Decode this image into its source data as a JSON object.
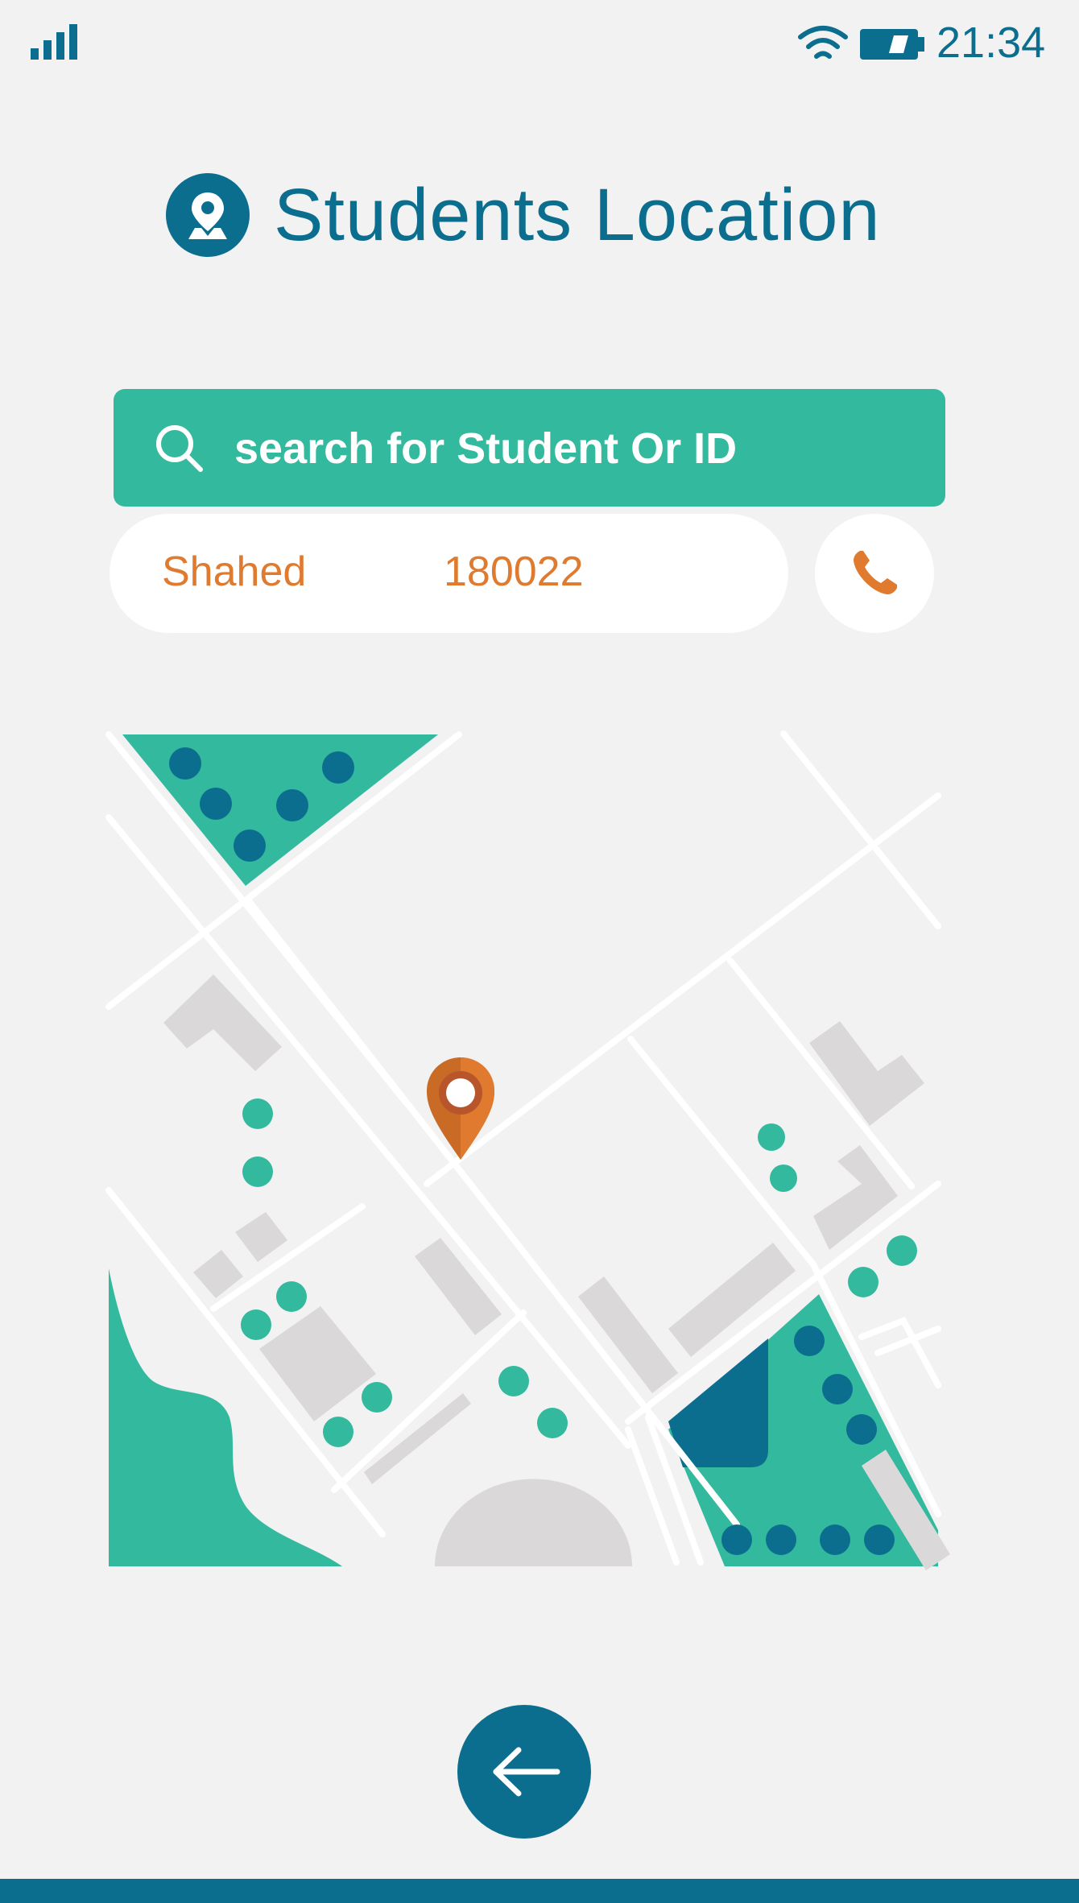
{
  "status": {
    "time": "21:34",
    "signal_icon": "signal-bars-icon",
    "wifi_icon": "wifi-icon",
    "battery_icon": "battery-icon"
  },
  "header": {
    "title": "Students Location",
    "icon": "map-pin-icon"
  },
  "search": {
    "placeholder": "search for Student Or ID",
    "value": ""
  },
  "student": {
    "name": "Shahed",
    "id": "180022",
    "call_icon": "phone-icon"
  },
  "map": {
    "marker_icon": "location-marker-icon"
  },
  "nav": {
    "back_icon": "arrow-left-icon"
  },
  "colors": {
    "primary": "#0b6e8f",
    "teal": "#33b99d",
    "orange": "#e07a2e",
    "background": "#f2f2f2"
  }
}
